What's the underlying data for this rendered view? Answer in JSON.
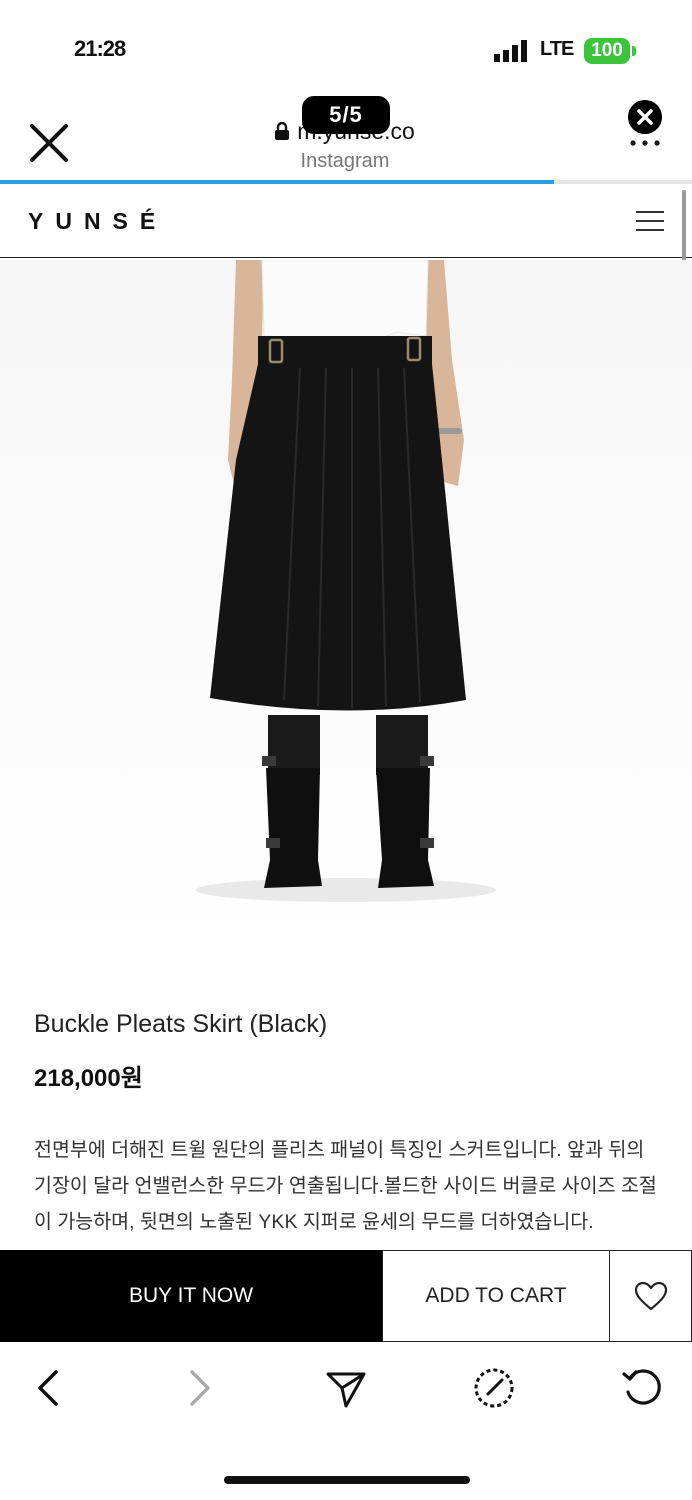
{
  "status_bar": {
    "time": "21:28",
    "network": "LTE",
    "battery": "100"
  },
  "browser": {
    "url": "m.yunse.co",
    "source": "Instagram",
    "counter": "5/5",
    "load_progress": 0.8
  },
  "site": {
    "logo": "YUNSÉ"
  },
  "product": {
    "name": "Buckle Pleats Skirt (Black)",
    "price": "218,000원",
    "description": "전면부에 더해진 트윌 원단의 플리츠 패널이 특징인 스커트입니다. 앞과 뒤의 기장이 달라 언밸런스한 무드가 연출됩니다.볼드한 사이드 버클로 사이즈 조절이 가능하며, 뒷면의 노출된 YKK 지퍼로 윤세의 무드를 더하였습니다."
  },
  "actions": {
    "buy_now": "BUY IT NOW",
    "add_to_cart": "ADD TO CART"
  },
  "icons": {
    "close": "close-icon",
    "lock": "lock-icon",
    "more": "more-icon",
    "menu": "hamburger-icon",
    "wishlist": "heart-icon",
    "back": "chevron-left-icon",
    "forward": "chevron-right-icon",
    "share": "send-icon",
    "safari": "compass-icon",
    "reload": "reload-icon"
  }
}
